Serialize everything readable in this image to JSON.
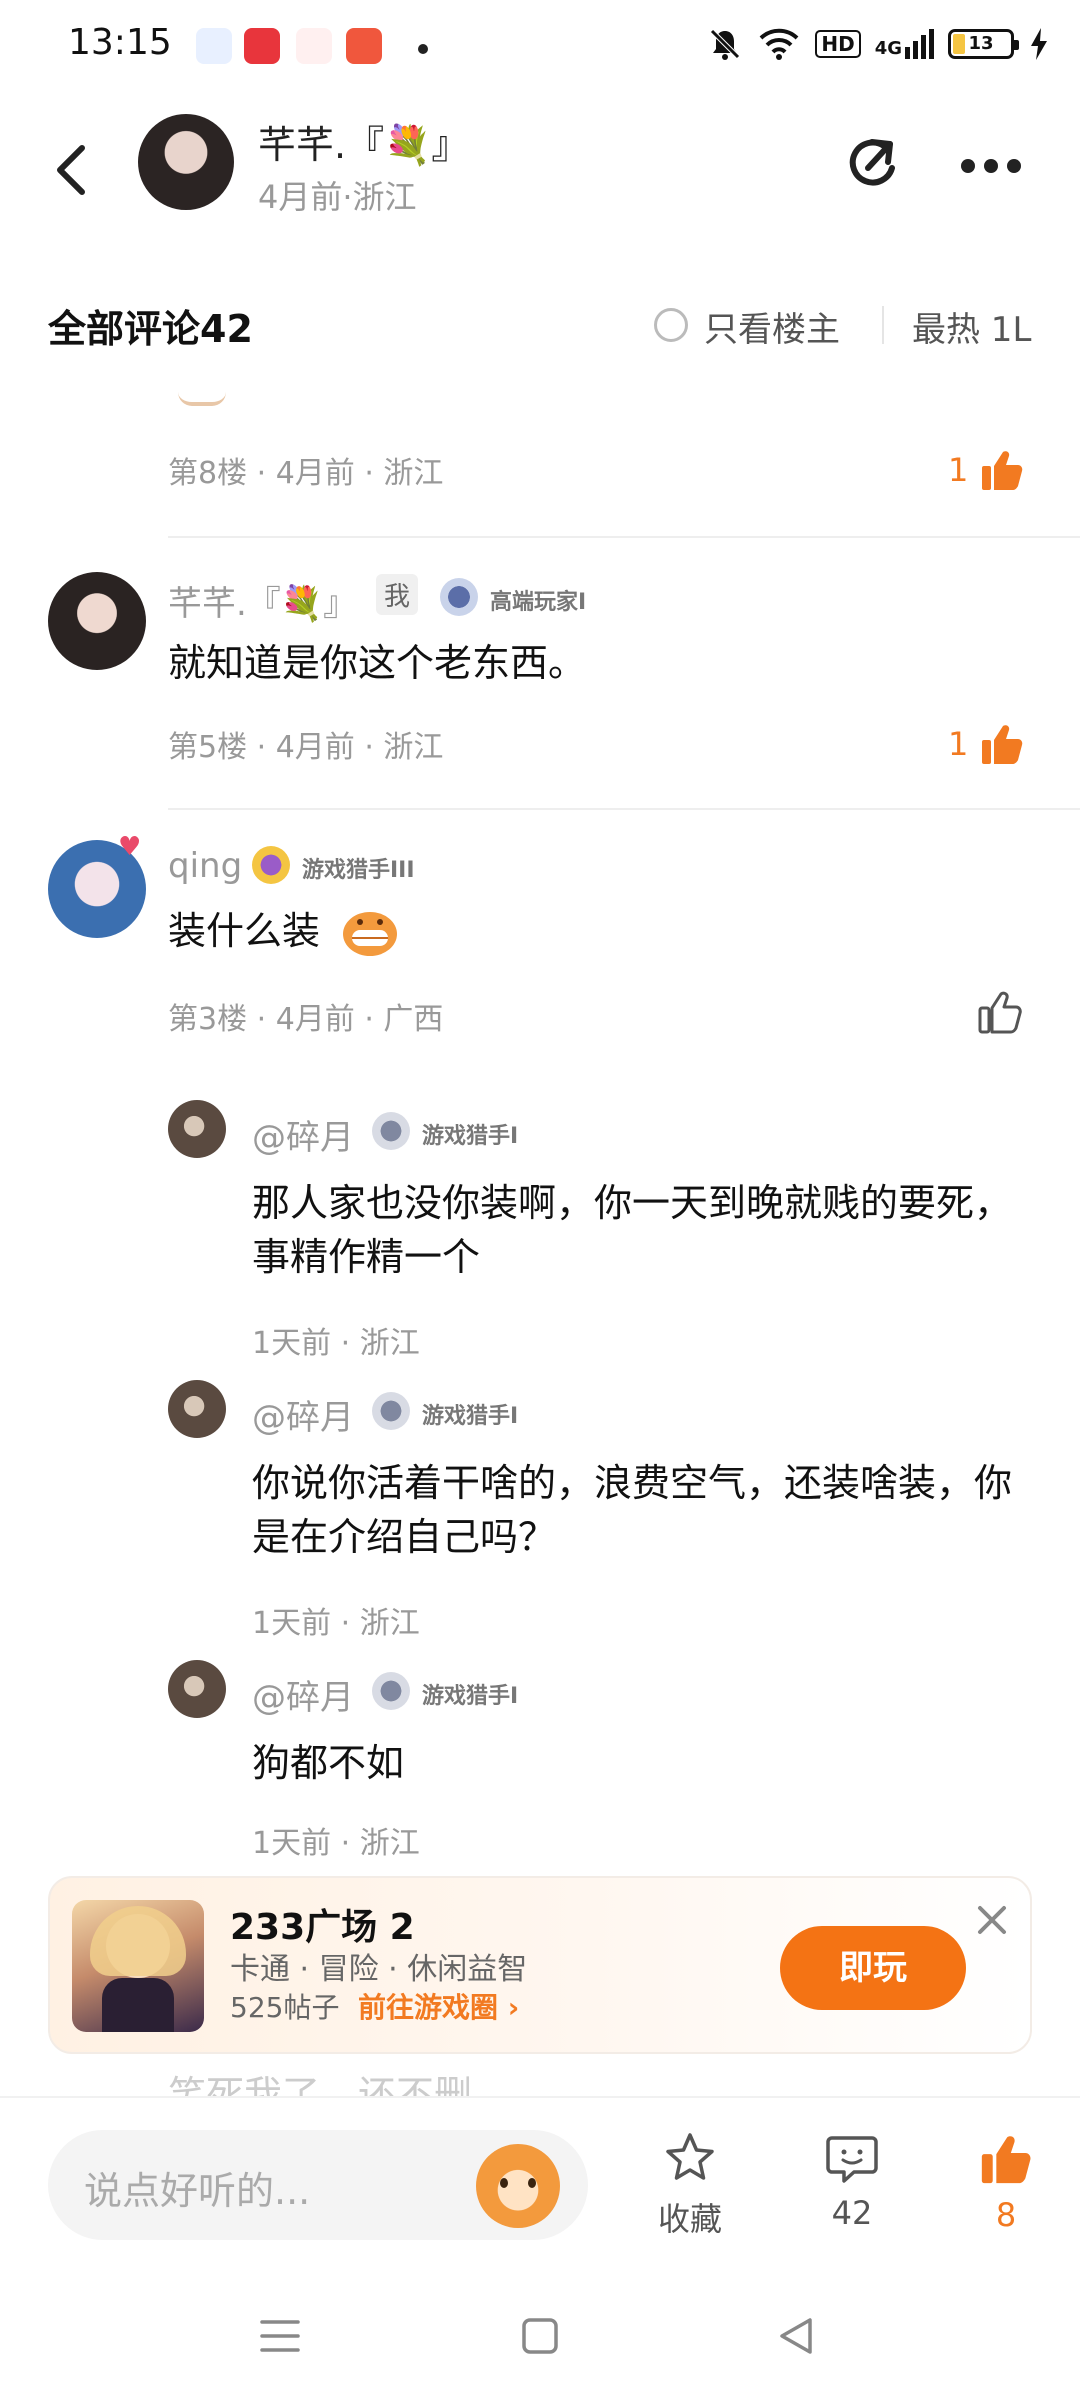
{
  "status_bar": {
    "time": "13:15",
    "network_tag": "HD",
    "signal_tag": "4G",
    "battery": "13"
  },
  "header": {
    "user_name": "芊芊.『💐』",
    "subtitle": "4月前·浙江"
  },
  "comments_bar": {
    "title": "全部评论42",
    "only_op": "只看楼主",
    "sort": "最热 1L"
  },
  "floor8": {
    "meta": "第8楼 · 4月前 · 浙江",
    "likes": "1"
  },
  "floor5": {
    "name": "芊芊.『💐』",
    "me_badge": "我",
    "level": "高端玩家I",
    "text": "就知道是你这个老东西。",
    "meta": "第5楼 · 4月前 · 浙江",
    "likes": "1"
  },
  "floor3": {
    "name": "qing",
    "level": "游戏猎手III",
    "text": "装什么装",
    "meta": "第3楼 · 4月前 · 广西",
    "replies": [
      {
        "name": "@碎月",
        "level": "游戏猎手I",
        "text": "那人家也没你装啊，你一天到晚就贱的要死，事精作精一个",
        "meta": "1天前 · 浙江"
      },
      {
        "name": "@碎月",
        "level": "游戏猎手I",
        "text": "你说你活着干啥的，浪费空气，还装啥装，你是在介绍自己吗？",
        "meta": "1天前 · 浙江"
      },
      {
        "name": "@碎月",
        "level": "游戏猎手I",
        "text": "狗都不如",
        "meta": "1天前 · 浙江"
      }
    ]
  },
  "ad": {
    "title": "233广场 2",
    "tags": "卡通 · 冒险 · 休闲益智",
    "posts": "525帖子",
    "link": "前往游戏圈",
    "play": "即玩"
  },
  "peek_text": "笑死我了，还不删",
  "bottom": {
    "input_placeholder": "说点好听的...",
    "favorite": "收藏",
    "comments_count": "42",
    "likes_count": "8"
  },
  "colors": {
    "accent": "#f27a21",
    "play_button": "#f47314"
  }
}
